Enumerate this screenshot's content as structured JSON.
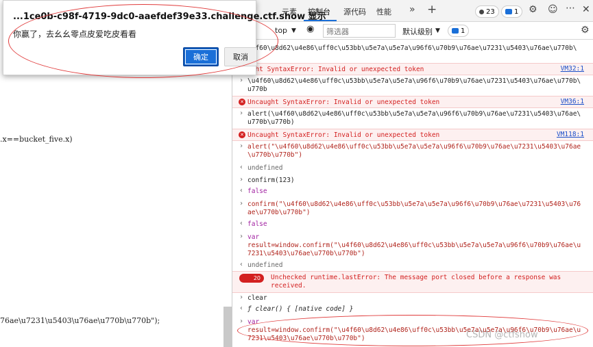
{
  "dialog": {
    "title": "...1ce0b-c98f-4719-9dc0-aaefdef39e33.challenge.ctf.show 显示",
    "message": "你赢了，去幺幺零点皮爱吃皮看看",
    "ok_label": "确定",
    "cancel_label": "取消"
  },
  "page": {
    "fragment_top": ".x==bucket_five.x)",
    "fragment_bottom": "76ae\\u7231\\u5403\\u76ae\\u770b\\u770b\");"
  },
  "devtools": {
    "tabs": {
      "elements": "元素",
      "console": "控制台",
      "sources": "源代码",
      "performance": "性能"
    },
    "more_icon": "»",
    "add_icon": "+",
    "issues_count": "23",
    "messages_count": "1",
    "context": "top",
    "filter_placeholder": "筛选器",
    "level": "默认级别",
    "filter_badge_count": "1"
  },
  "console": {
    "r0": "u4f60\\u8d62\\u4e86\\uff0c\\u53bb\\u5e7a\\u5e7a\\u96f6\\u70b9\\u76ae\\u7231\\u5403\\u76ae\\u770b\\",
    "r1_err": "ught SyntaxError: Invalid or unexpected token",
    "r1_link": "VM32:1",
    "r2_a": "\\u4f60\\u8d62\\u4e86\\uff0c\\u53bb\\u5e7a\\u5e7a\\u96f6\\u70b9\\u76ae\\u7231\\u5403\\u76ae\\u770b\\",
    "r2_b": "u770b",
    "r3_err": "Uncaught SyntaxError: Invalid or unexpected token",
    "r3_link": "VM36:1",
    "r4_a": "alert(\\u4f60\\u8d62\\u4e86\\uff0c\\u53bb\\u5e7a\\u5e7a\\u96f6\\u70b9\\u76ae\\u7231\\u5403\\u76ae\\",
    "r4_b": "u770b\\u770b)",
    "r5_err": "Uncaught SyntaxError: Invalid or unexpected token",
    "r5_link": "VM118:1",
    "r6_a": "alert(\"\\u4f60\\u8d62\\u4e86\\uff0c\\u53bb\\u5e7a\\u5e7a\\u96f6\\u70b9\\u76ae\\u7231\\u5403\\u76ae",
    "r6_b": "\\u770b\\u770b\")",
    "r7": "undefined",
    "r8": "confirm(123)",
    "r9": "false",
    "r10_a": "confirm(\"\\u4f60\\u8d62\\u4e86\\uff0c\\u53bb\\u5e7a\\u5e7a\\u96f6\\u70b9\\u76ae\\u7231\\u5403\\u76",
    "r10_b": "ae\\u770b\\u770b\")",
    "r11": "false",
    "r12_kw": "var",
    "r12_a": "result=window.confirm(\"\\u4f60\\u8d62\\u4e86\\uff0c\\u53bb\\u5e7a\\u5e7a\\u96f6\\u70b9\\u76ae\\u",
    "r12_b": "7231\\u5403\\u76ae\\u770b\\u770b\")",
    "r13": "undefined",
    "r14_pill": "20",
    "r14_a": "Unchecked runtime.lastError: The message port closed before a response was",
    "r14_b": "received.",
    "r15": "clear",
    "r16": "ƒ clear() { [native code] }",
    "r17_kw": "var",
    "r17_a": "result=window.confirm(\"\\u4f60\\u8d62\\u4e86\\uff0c\\u53bb\\u5e7a\\u5e7a\\u96f6\\u70b9\\u76ae\\u",
    "r17_b": "7231\\u5403\\u76ae\\u770b\\u770b\")"
  },
  "watermark": "CSDN @ctfshow"
}
